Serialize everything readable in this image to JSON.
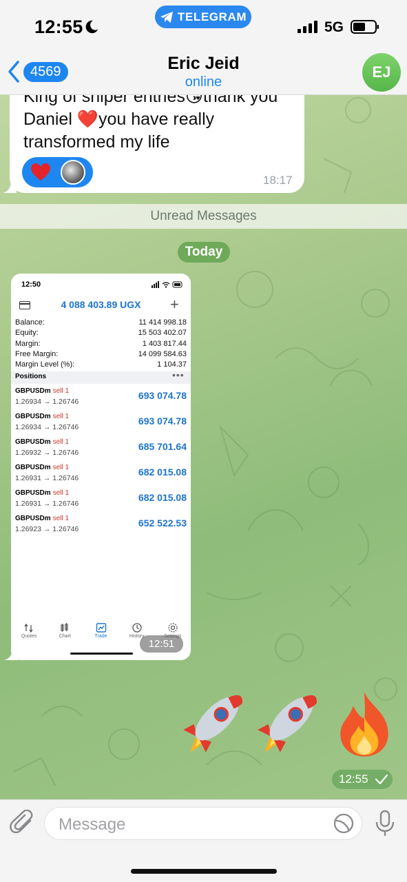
{
  "status_bar": {
    "time": "12:55",
    "network": "5G",
    "telegram_label": "TELEGRAM"
  },
  "header": {
    "back_count": "4569",
    "title": "Eric Jeid",
    "status": "online",
    "avatar_initials": "EJ"
  },
  "message1": {
    "text_line1": "King of sniper entries😘thank you",
    "text_line2_before": "Daniel ",
    "text_line2_heart": "❤️",
    "text_line2_after": "you have really",
    "text_line3": "transformed my life",
    "time": "18:17"
  },
  "unread_label": "Unread Messages",
  "date_pill": "Today",
  "screenshot": {
    "time": "12:50",
    "equity_title": "4 088 403.89 UGX",
    "summary": [
      {
        "label": "Balance:",
        "value": "11 414 998.18"
      },
      {
        "label": "Equity:",
        "value": "15 503 402.07"
      },
      {
        "label": "Margin:",
        "value": "1 403 817.44"
      },
      {
        "label": "Free Margin:",
        "value": "14 099 584.63"
      },
      {
        "label": "Margin Level (%):",
        "value": "1 104.37"
      }
    ],
    "positions_title": "Positions",
    "trades": [
      {
        "symbol": "GBPUSDm",
        "side": "sell 1",
        "prices": "1.26934 → 1.26746",
        "profit": "693 074.78"
      },
      {
        "symbol": "GBPUSDm",
        "side": "sell 1",
        "prices": "1.26934 → 1.26746",
        "profit": "693 074.78"
      },
      {
        "symbol": "GBPUSDm",
        "side": "sell 1",
        "prices": "1.26932 → 1.26746",
        "profit": "685 701.64"
      },
      {
        "symbol": "GBPUSDm",
        "side": "sell 1",
        "prices": "1.26931 → 1.26746",
        "profit": "682 015.08"
      },
      {
        "symbol": "GBPUSDm",
        "side": "sell 1",
        "prices": "1.26931 → 1.26746",
        "profit": "682 015.08"
      },
      {
        "symbol": "GBPUSDm",
        "side": "sell 1",
        "prices": "1.26923 → 1.26746",
        "profit": "652 522.53"
      }
    ],
    "tabs": [
      "Quotes",
      "Chart",
      "Trade",
      "History",
      "Settings"
    ],
    "active_tab": "Trade",
    "message_time": "12:51"
  },
  "emoji_message": {
    "emojis": [
      "rocket-icon",
      "rocket-icon",
      "fire-icon"
    ],
    "time": "12:55"
  },
  "composer": {
    "placeholder": "Message"
  },
  "colors": {
    "accent": "#1e86f0",
    "avatar": "#5fbf52",
    "sell": "#d1322b",
    "profit": "#1d73d1"
  }
}
